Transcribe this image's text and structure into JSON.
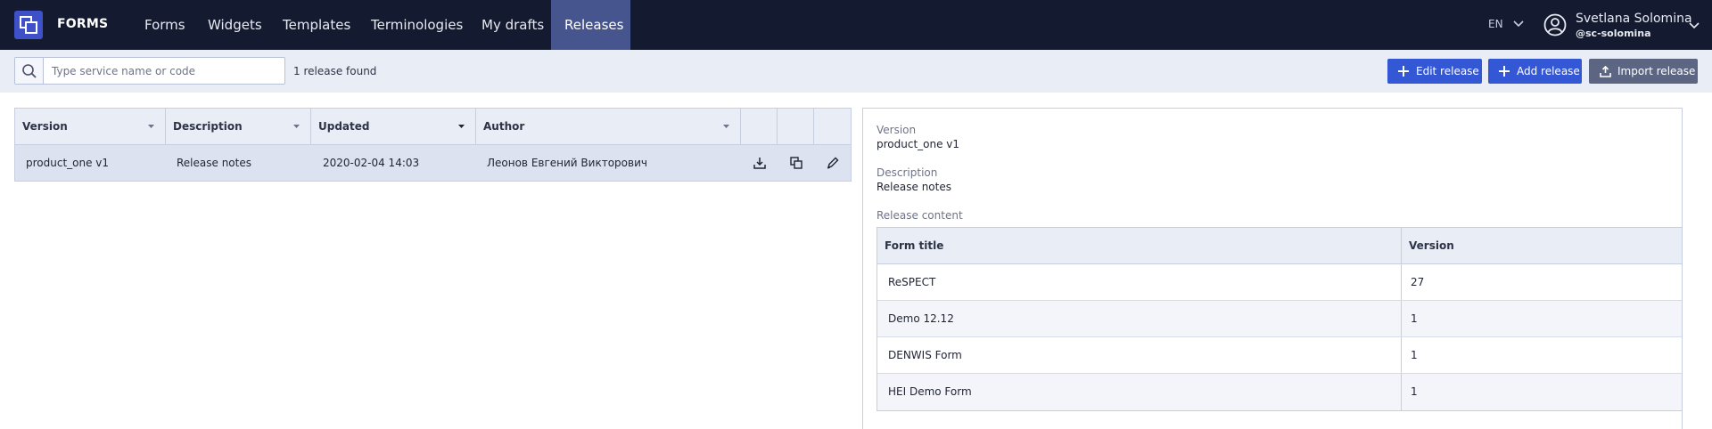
{
  "app": {
    "brand": "FORMS"
  },
  "nav": {
    "items": [
      {
        "label": "Forms"
      },
      {
        "label": "Widgets"
      },
      {
        "label": "Templates"
      },
      {
        "label": "Terminologies"
      },
      {
        "label": "My drafts"
      },
      {
        "label": "Releases",
        "active": true
      }
    ]
  },
  "user": {
    "lang": "EN",
    "name": "Svetlana Solomina",
    "handle": "@sc-solomina"
  },
  "toolbar": {
    "search_placeholder": "Type service name or code",
    "found_text": "1 release found",
    "edit_label": "Edit release",
    "add_label": "Add release",
    "import_label": "Import release"
  },
  "releases": {
    "columns": [
      "Version",
      "Description",
      "Updated",
      "Author"
    ],
    "rows": [
      {
        "version": "product_one v1",
        "description": "Release notes",
        "updated": "2020-02-04 14:03",
        "author": "Леонов Евгений Викторович"
      }
    ]
  },
  "details": {
    "version_label": "Version",
    "version_value": "product_one v1",
    "description_label": "Description",
    "description_value": "Release notes",
    "content_label": "Release content",
    "columns": [
      "Form title",
      "Version"
    ],
    "rows": [
      {
        "title": "ReSPECT",
        "version": "27"
      },
      {
        "title": "Demo 12.12",
        "version": "1"
      },
      {
        "title": "DENWIS Form",
        "version": "1"
      },
      {
        "title": "HEI Demo Form",
        "version": "1"
      }
    ]
  },
  "colors": {
    "nav_bg": "#141b30",
    "nav_active": "#46558e",
    "accent": "#3457d5",
    "toolbar_bg": "#e9edf5"
  }
}
